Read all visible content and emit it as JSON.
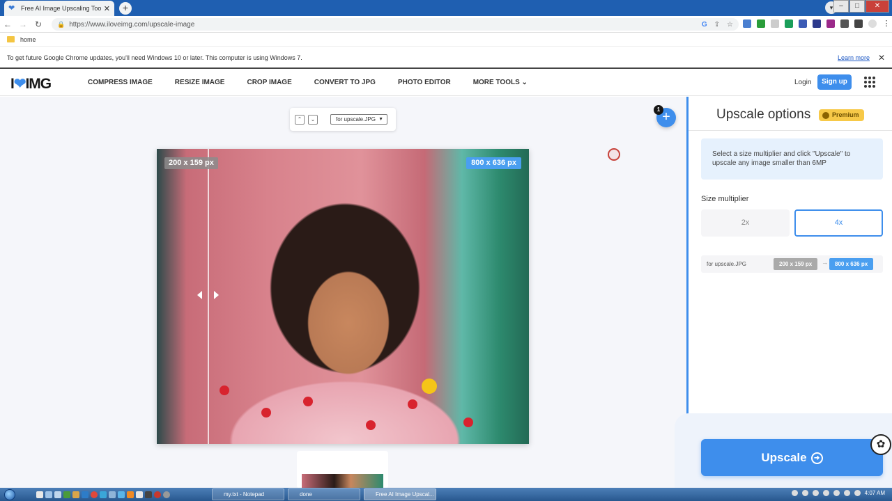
{
  "browser": {
    "tab_title": "Free AI Image Upscaling Tool - I",
    "url": "https://www.iloveimg.com/upscale-image",
    "bookmark": "home",
    "update_notice": "To get future Google Chrome updates, you'll need Windows 10 or later. This computer is using Windows 7.",
    "learn_more": "Learn more"
  },
  "site": {
    "logo": {
      "left": "I",
      "heart": "❤",
      "right": "IMG"
    },
    "menu": [
      "COMPRESS IMAGE",
      "RESIZE IMAGE",
      "CROP IMAGE",
      "CONVERT TO JPG",
      "PHOTO EDITOR",
      "MORE TOOLS"
    ],
    "login": "Login",
    "signup": "Sign up"
  },
  "workspace": {
    "file_select": "for upscale.JPG",
    "add_badge": "1",
    "original_dims": "200 x 159 px",
    "upscaled_dims": "800 x 636 px",
    "compare_position": 0.14
  },
  "panel": {
    "title": "Upscale options",
    "premium": "Premium",
    "info": "Select a size multiplier and click \"Upscale\" to upscale any image smaller than 6MP",
    "size_label": "Size multiplier",
    "options": [
      "2x",
      "4x"
    ],
    "selected_option": "4x",
    "file_name": "for upscale.JPG",
    "from_dims": "200 x 159 px",
    "to_dims": "800 x 636 px",
    "upscale_button": "Upscale"
  },
  "taskbar": {
    "tasks": [
      "my.txt - Notepad",
      "done",
      "Free AI Image Upscal..."
    ],
    "clock": "4:07 AM"
  },
  "colors": {
    "accent": "#3e8eec",
    "premium": "#f7c948",
    "titlebar": "#1f5fb1"
  }
}
